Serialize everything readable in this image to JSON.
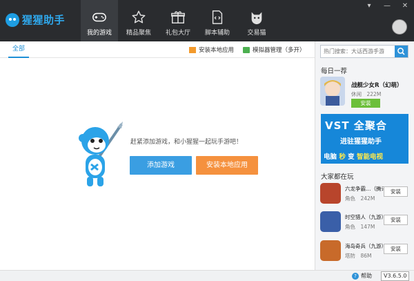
{
  "app": {
    "name": "猩猩助手"
  },
  "nav": [
    {
      "label": "我的游戏",
      "icon": "gamepad-icon",
      "active": true
    },
    {
      "label": "精品聚焦",
      "icon": "star-icon",
      "active": false
    },
    {
      "label": "礼包大厅",
      "icon": "gift-icon",
      "active": false
    },
    {
      "label": "脚本辅助",
      "icon": "script-file-icon",
      "active": false
    },
    {
      "label": "交易猫",
      "icon": "cat-icon",
      "active": false
    }
  ],
  "window_controls": [
    "▾",
    "—",
    "✕"
  ],
  "main": {
    "tab_all": "全部",
    "install_local_app": "安装本地应用",
    "emulator_manage": "模拟器管理（多开）",
    "empty_hint": "赶紧添加游戏，和小猩猩一起玩手游吧！",
    "add_game_button": "添加游戏",
    "install_local_button": "安装本地应用"
  },
  "side": {
    "search_placeholder": "热门搜索：大话西游手游",
    "daily_title": "每日一荐",
    "featured": {
      "name": "战舰少女R（幻萌）",
      "meta": "休闲　222M",
      "button": "安装"
    },
    "banner": {
      "line1": "VST 全聚合",
      "line2": "进驻猩猩助手",
      "line3_a": "电脑",
      "line3_b": "秒",
      "line3_c": "变",
      "line3_d": "智能电视"
    },
    "playing_title": "大家都在玩",
    "playing": [
      {
        "name": "六龙争霸…（腾讯",
        "meta": "角色　242M",
        "button": "安装",
        "icon_color": "#b8452c"
      },
      {
        "name": "时空猎人（九游）",
        "meta": "角色　147M",
        "button": "安装",
        "icon_color": "#3a5fa8"
      },
      {
        "name": "海岛奇兵（九游）",
        "meta": "塔防　86M",
        "button": "安装",
        "icon_color": "#c86a2a"
      }
    ]
  },
  "status": {
    "help": "帮助",
    "version": "V3.6.5.0"
  },
  "colors": {
    "topbar": "#2a2c2f",
    "accent_blue": "#3a9ee2",
    "accent_orange": "#f5913e",
    "install_green": "#6cbf3a"
  }
}
